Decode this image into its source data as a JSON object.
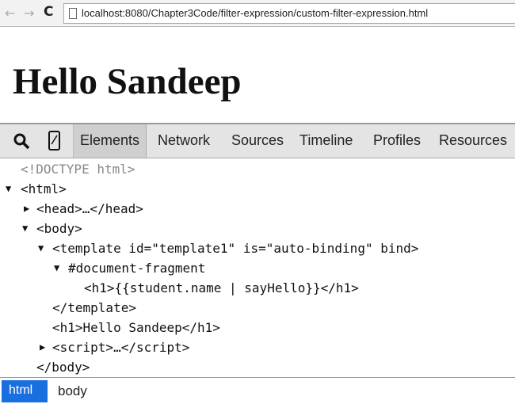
{
  "browser": {
    "back_icon": "←",
    "forward_icon": "→",
    "reload_icon": "C",
    "url": "localhost:8080/Chapter3Code/filter-expression/custom-filter-expression.html"
  },
  "page": {
    "heading": "Hello Sandeep"
  },
  "devtools": {
    "tabs": [
      "Elements",
      "Network",
      "Sources",
      "Timeline",
      "Profiles",
      "Resources"
    ],
    "tree": [
      "<!DOCTYPE html>",
      "<html>",
      "<head>…</head>",
      "<body>",
      "<template id=\"template1\" is=\"auto-binding\" bind>",
      "#document-fragment",
      "<h1>{{student.name | sayHello}}</h1>",
      "</template>",
      "<h1>Hello Sandeep</h1>",
      "<script>…</script>",
      "</body>"
    ],
    "breadcrumbs": [
      "html",
      "body"
    ]
  }
}
